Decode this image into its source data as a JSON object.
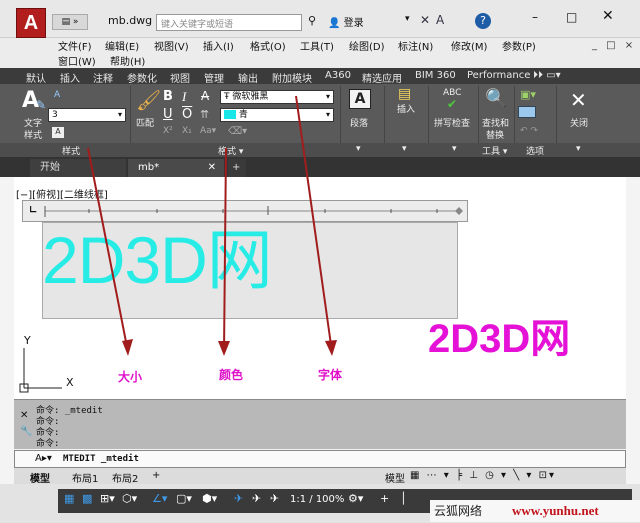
{
  "title_bar": {
    "app_button": "A",
    "qat_label": "▤ »",
    "document_title": "mb.dwg",
    "search_placeholder": "键入关键字或短语",
    "login_label": "登录",
    "help_label": "?",
    "min_label": "–",
    "max_label": "□",
    "close_label": "✕"
  },
  "menu_bar": {
    "row1": [
      "文件(F)",
      "编辑(E)",
      "视图(V)",
      "插入(I)",
      "格式(O)",
      "工具(T)",
      "绘图(D)",
      "标注(N)",
      "修改(M)",
      "参数(P)"
    ],
    "row2": [
      "窗口(W)",
      "帮助(H)"
    ],
    "mdi_controls": "_ □ ×"
  },
  "ribbon_tabs": [
    "默认",
    "插入",
    "注释",
    "参数化",
    "视图",
    "管理",
    "输出",
    "附加模块",
    "A360",
    "精选应用",
    "BIM 360",
    "Performance"
  ],
  "ribbon": {
    "style_panel": {
      "label": "样式",
      "text_style_label": "文字\n样式",
      "height_value": "3"
    },
    "format_panel": {
      "label": "格式",
      "match_label": "匹配",
      "bold": "B",
      "italic": "I",
      "strike": "A",
      "underline": "U",
      "overline": "O",
      "font_value": "微软雅黑",
      "color_value": "青",
      "color_swatch": "#19e6e6"
    },
    "paragraph_label": "段落",
    "insert_label": "插入",
    "spell_label": "拼写检查",
    "find_label": "查找和\n替换",
    "tools_label": "工具",
    "options_label": "选项",
    "close_label": "关闭"
  },
  "doc_tabs": {
    "start": "开始",
    "current": "mb*",
    "add": "+"
  },
  "drawing": {
    "view_label": "[−][俯视][二维线框]",
    "cyan_text": "2D3D网",
    "magenta_text": "2D3D网",
    "text_color": "#27ece6",
    "magenta_color": "#e511d6",
    "annotations": [
      "大小",
      "颜色",
      "字体"
    ],
    "ucs_y": "Y",
    "ucs_x": "X"
  },
  "command_line": {
    "history": [
      "命令: _mtedit",
      "命令:",
      "命令:",
      "命令:"
    ],
    "current": "MTEDIT _mtedit"
  },
  "layout_tabs": [
    "模型",
    "布局1",
    "布局2"
  ],
  "status_bar": {
    "model_label": "模型",
    "scale": "1:1 / 100%",
    "watermark_text": "云狐网络",
    "watermark_url": "www.yunhu.net"
  }
}
